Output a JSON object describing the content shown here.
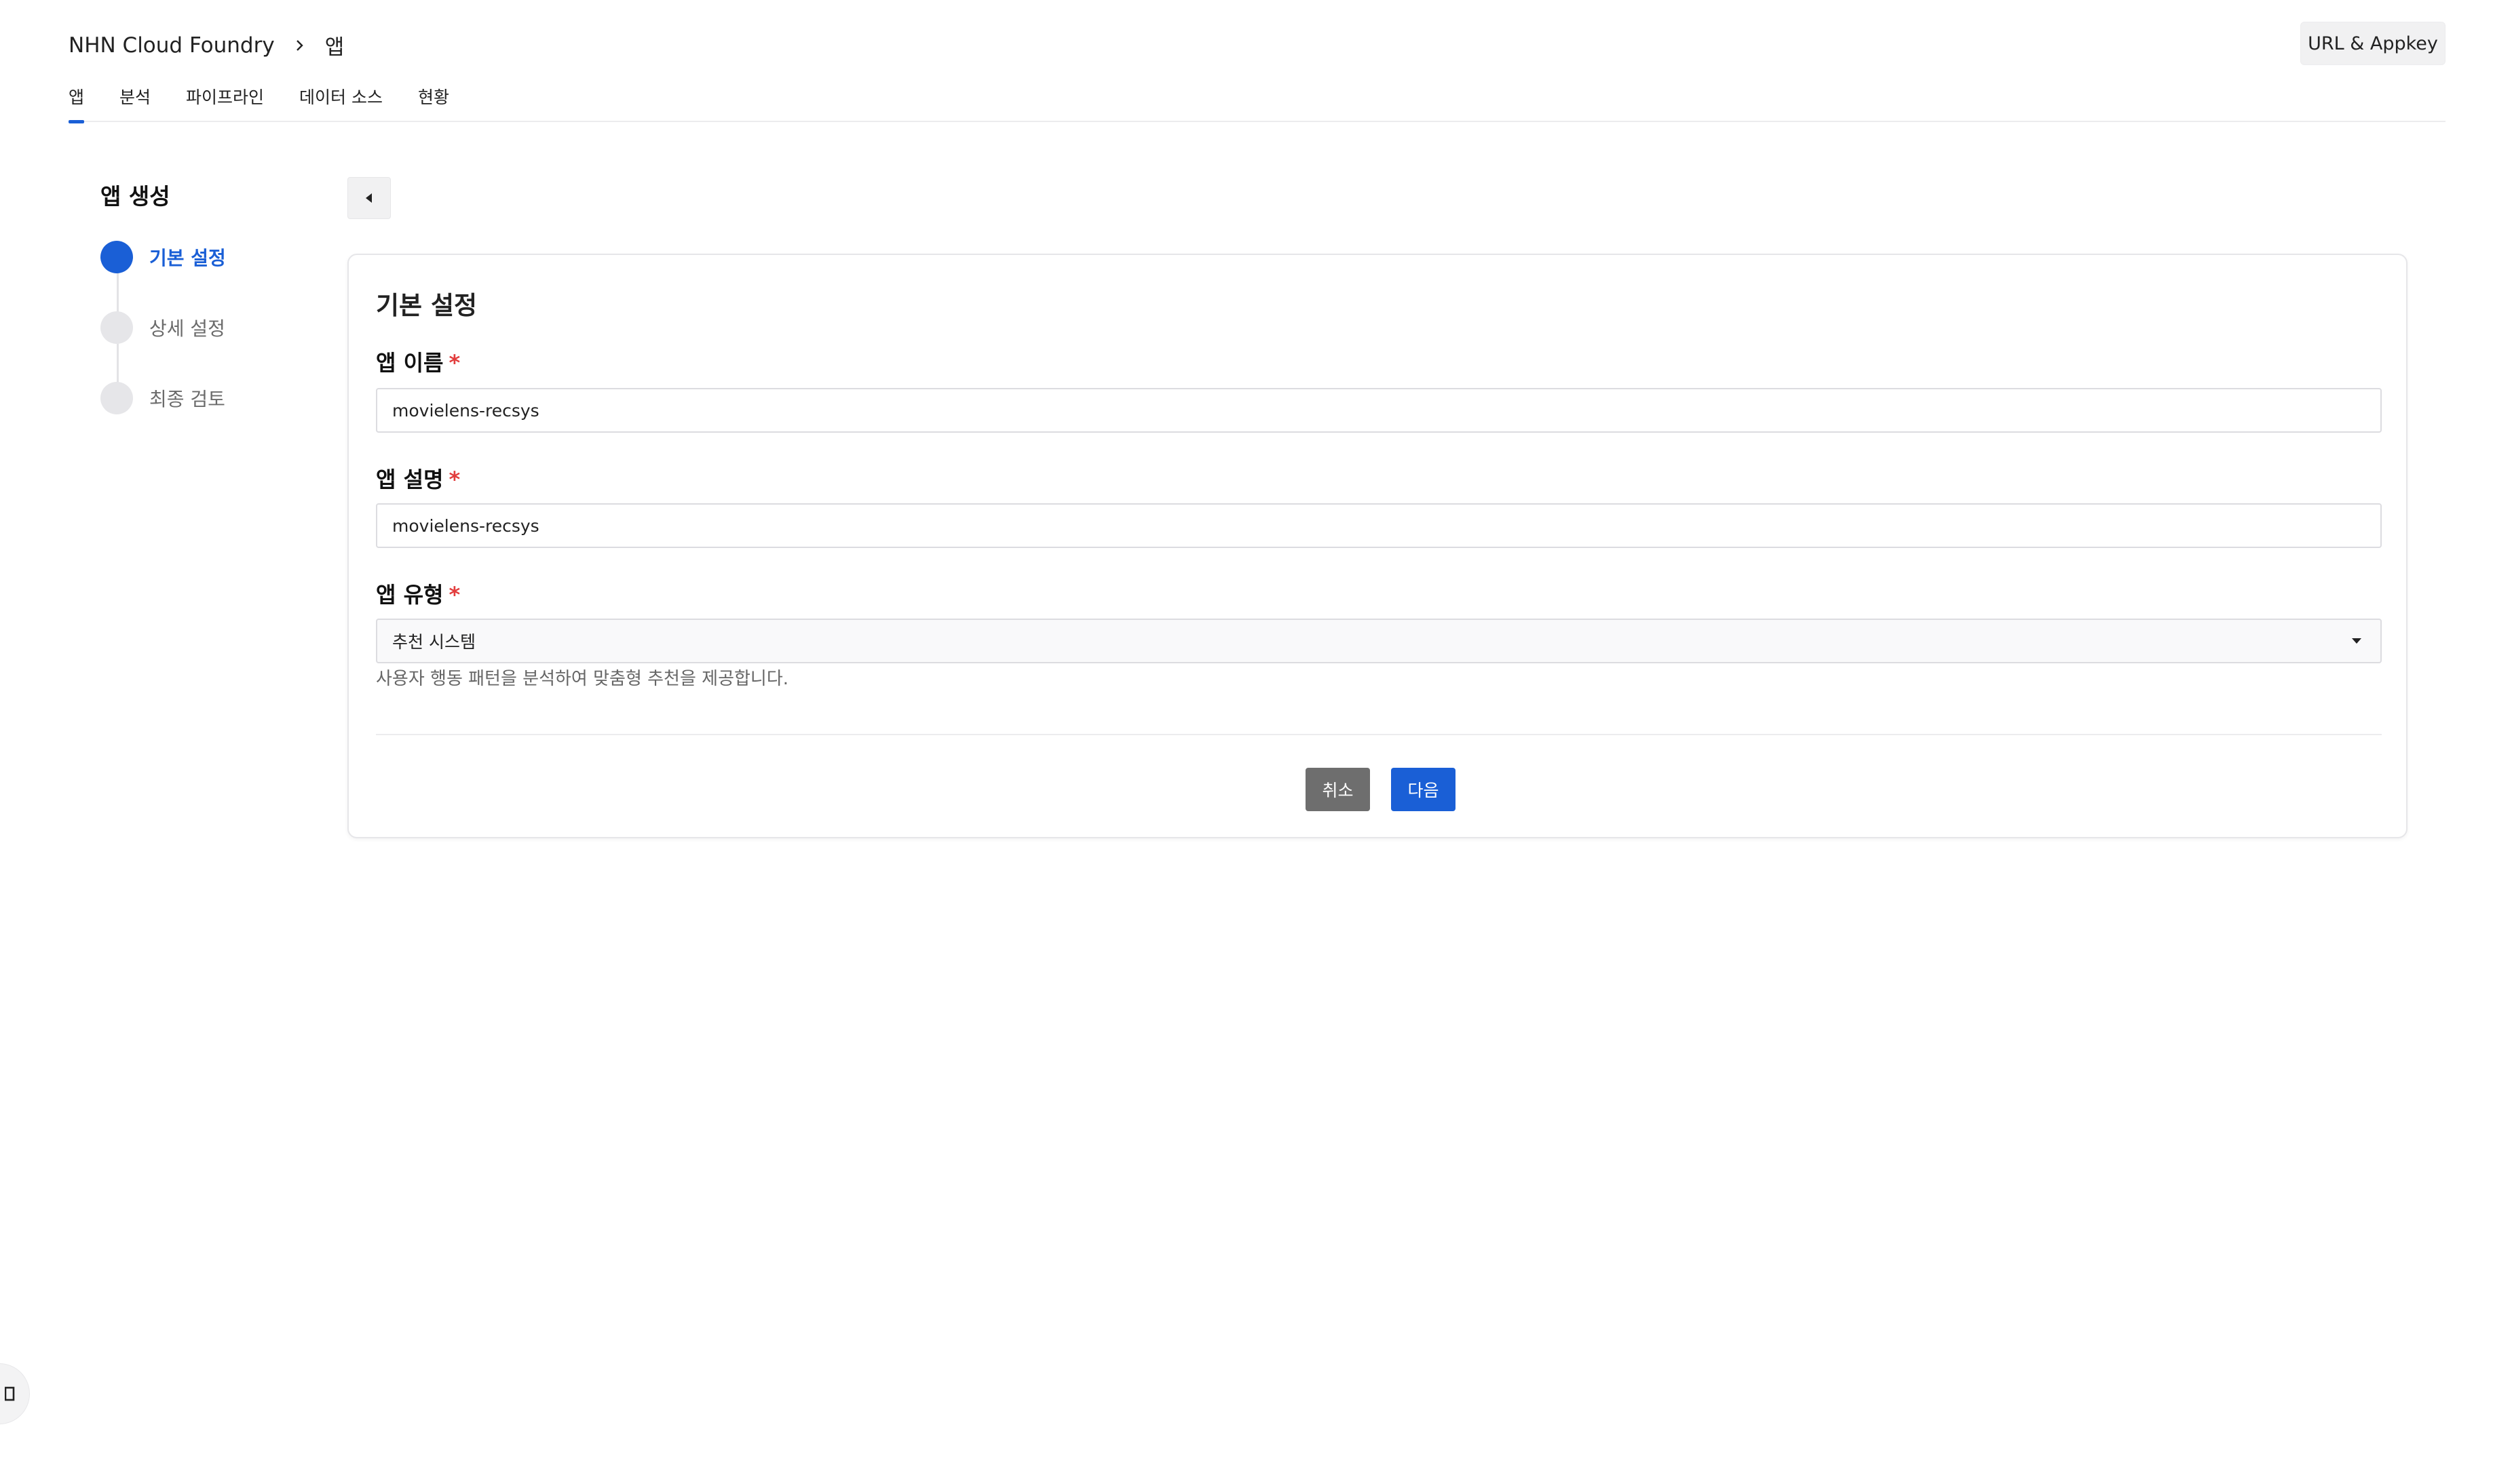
{
  "header": {
    "breadcrumb": [
      "NHN Cloud Foundry",
      "앱"
    ],
    "url_appkey_label": "URL & Appkey"
  },
  "tabs": [
    {
      "label": "앱",
      "active": true
    },
    {
      "label": "분석",
      "active": false
    },
    {
      "label": "파이프라인",
      "active": false
    },
    {
      "label": "데이터 소스",
      "active": false
    },
    {
      "label": "현황",
      "active": false
    }
  ],
  "sidebar": {
    "title": "앱 생성",
    "steps": [
      {
        "label": "기본 설정",
        "active": true
      },
      {
        "label": "상세 설정",
        "active": false
      },
      {
        "label": "최종 검토",
        "active": false
      }
    ]
  },
  "form": {
    "title": "기본 설정",
    "app_name": {
      "label": "앱 이름",
      "required_mark": "*",
      "value": "movielens-recsys"
    },
    "app_desc": {
      "label": "앱 설명",
      "required_mark": "*",
      "value": "movielens-recsys"
    },
    "app_type": {
      "label": "앱 유형",
      "required_mark": "*",
      "selected": "추천 시스템",
      "help": "사용자 행동 패턴을 분석하여 맞춤형 추천을 제공합니다."
    },
    "cancel_label": "취소",
    "next_label": "다음"
  },
  "colors": {
    "accent": "#1a5fd6",
    "required": "#e23d3d",
    "cancel_bg": "#6e6e6e"
  },
  "icons": {
    "breadcrumb_separator": "chevron-right-icon",
    "back": "caret-left-icon",
    "select": "caret-down-icon"
  }
}
